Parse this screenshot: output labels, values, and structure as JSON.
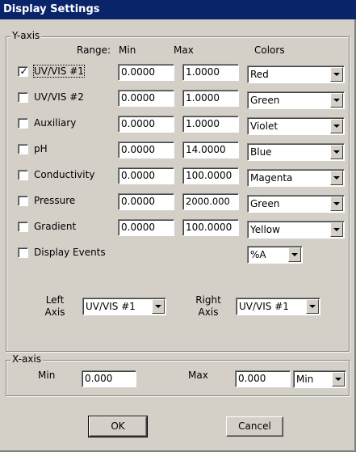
{
  "window": {
    "title": "Display Settings"
  },
  "yaxis": {
    "group_label": "Y-axis",
    "headers": {
      "range": "Range:",
      "min": "Min",
      "max": "Max",
      "colors": "Colors"
    },
    "rows": [
      {
        "label": "UV/VIS #1",
        "checked": true,
        "min": "0.0000",
        "max": "1.0000",
        "color": "Red"
      },
      {
        "label": "UV/VIS #2",
        "checked": false,
        "min": "0.0000",
        "max": "1.0000",
        "color": "Green"
      },
      {
        "label": "Auxiliary",
        "checked": false,
        "min": "0.0000",
        "max": "1.0000",
        "color": "Violet"
      },
      {
        "label": "pH",
        "checked": false,
        "min": "0.0000",
        "max": "14.0000",
        "color": "Blue"
      },
      {
        "label": "Conductivity",
        "checked": false,
        "min": "0.0000",
        "max": "100.0000",
        "color": "Magenta"
      },
      {
        "label": "Pressure",
        "checked": false,
        "min": "0.0000",
        "max": "2000.000",
        "color": "Green"
      },
      {
        "label": "Gradient",
        "checked": false,
        "min": "0.0000",
        "max": "100.0000",
        "color": "Yellow"
      }
    ],
    "display_events": {
      "label": "Display Events",
      "checked": false,
      "value": "%A"
    },
    "left_axis": {
      "label_line1": "Left",
      "label_line2": "Axis",
      "value": "UV/VIS #1"
    },
    "right_axis": {
      "label_line1": "Right",
      "label_line2": "Axis",
      "value": "UV/VIS #1"
    }
  },
  "xaxis": {
    "group_label": "X-axis",
    "min_label": "Min",
    "min_value": "0.000",
    "max_label": "Max",
    "max_value": "0.000",
    "unit": "Min"
  },
  "buttons": {
    "ok": "OK",
    "cancel": "Cancel"
  }
}
